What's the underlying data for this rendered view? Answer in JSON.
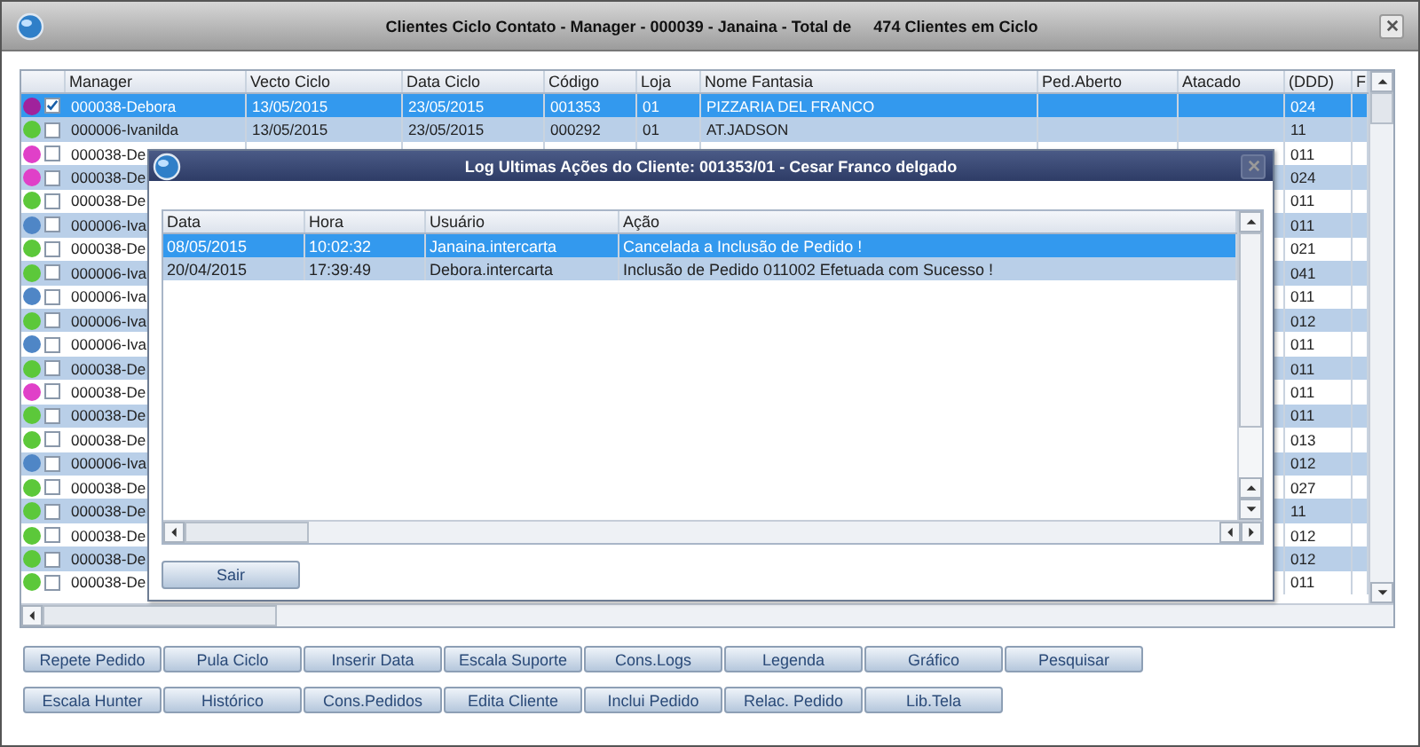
{
  "main_window": {
    "title": "Clientes Ciclo Contato - Manager - 000039 - Janaina - Total de     474 Clientes em Ciclo",
    "table": {
      "columns": [
        "Manager",
        "Vecto Ciclo",
        "Data Ciclo",
        "Código",
        "Loja",
        "Nome Fantasia",
        "Ped.Aberto",
        "Atacado",
        "(DDD)",
        "F"
      ],
      "rows": [
        {
          "color": "#a0229c",
          "checked": true,
          "selected": true,
          "manager": "000038-Debora",
          "details": [
            "13/05/2015",
            "23/05/2015",
            "001353",
            "01",
            "PIZZARIA DEL FRANCO"
          ],
          "ddd": "024"
        },
        {
          "color": "#5cc83a",
          "checked": false,
          "selected": false,
          "manager": "000006-Ivanilda",
          "details": [
            "13/05/2015",
            "23/05/2015",
            "000292",
            "01",
            "AT.JADSON"
          ],
          "ddd": "11"
        },
        {
          "color": "#e040c8",
          "checked": false,
          "selected": false,
          "manager": "000038-De",
          "ddd": "011"
        },
        {
          "color": "#e040c8",
          "checked": false,
          "selected": false,
          "manager": "000038-De",
          "ddd": "024"
        },
        {
          "color": "#5cc83a",
          "checked": false,
          "selected": false,
          "manager": "000038-De",
          "ddd": "011"
        },
        {
          "color": "#4f86c6",
          "checked": false,
          "selected": false,
          "manager": "000006-Iva",
          "ddd": "011"
        },
        {
          "color": "#5cc83a",
          "checked": false,
          "selected": false,
          "manager": "000038-De",
          "ddd": "021"
        },
        {
          "color": "#5cc83a",
          "checked": false,
          "selected": false,
          "manager": "000006-Iva",
          "ddd": "041"
        },
        {
          "color": "#4f86c6",
          "checked": false,
          "selected": false,
          "manager": "000006-Iva",
          "ddd": "011"
        },
        {
          "color": "#5cc83a",
          "checked": false,
          "selected": false,
          "manager": "000006-Iva",
          "ddd": "012"
        },
        {
          "color": "#4f86c6",
          "checked": false,
          "selected": false,
          "manager": "000006-Iva",
          "ddd": "011"
        },
        {
          "color": "#5cc83a",
          "checked": false,
          "selected": false,
          "manager": "000038-De",
          "ddd": "011"
        },
        {
          "color": "#e040c8",
          "checked": false,
          "selected": false,
          "manager": "000038-De",
          "ddd": "011"
        },
        {
          "color": "#5cc83a",
          "checked": false,
          "selected": false,
          "manager": "000038-De",
          "ddd": "011"
        },
        {
          "color": "#5cc83a",
          "checked": false,
          "selected": false,
          "manager": "000038-De",
          "ddd": "013"
        },
        {
          "color": "#4f86c6",
          "checked": false,
          "selected": false,
          "manager": "000006-Iva",
          "ddd": "012"
        },
        {
          "color": "#5cc83a",
          "checked": false,
          "selected": false,
          "manager": "000038-De",
          "ddd": "027"
        },
        {
          "color": "#5cc83a",
          "checked": false,
          "selected": false,
          "manager": "000038-De",
          "ddd": "11"
        },
        {
          "color": "#5cc83a",
          "checked": false,
          "selected": false,
          "manager": "000038-De",
          "ddd": "012"
        },
        {
          "color": "#5cc83a",
          "checked": false,
          "selected": false,
          "manager": "000038-De",
          "ddd": "012"
        },
        {
          "color": "#5cc83a",
          "checked": false,
          "selected": false,
          "manager": "000038-De",
          "ddd": "011"
        }
      ]
    },
    "buttons": [
      [
        "Repete Pedido",
        "Pula Ciclo",
        "Inserir Data",
        "Escala Suporte",
        "Cons.Logs",
        "Legenda",
        "Gráfico",
        "Pesquisar"
      ],
      [
        "Escala Hunter",
        "Histórico",
        "Cons.Pedidos",
        "Edita Cliente",
        "Inclui Pedido",
        "Relac. Pedido",
        "Lib.Tela"
      ]
    ]
  },
  "dialog": {
    "title": "Log Ultimas Ações do Cliente: 001353/01 - Cesar Franco delgado",
    "table": {
      "columns": [
        "Data",
        "Hora",
        "Usuário",
        "Ação"
      ],
      "rows": [
        {
          "selected": true,
          "cells": [
            "08/05/2015",
            "10:02:32",
            "Janaina.intercarta",
            "Cancelada a Inclusão de Pedido !"
          ]
        },
        {
          "selected": false,
          "cells": [
            "20/04/2015",
            "17:39:49",
            "Debora.intercarta",
            "Inclusão de Pedido 011002 Efetuada com Sucesso !"
          ]
        }
      ]
    },
    "button": "Sair"
  }
}
